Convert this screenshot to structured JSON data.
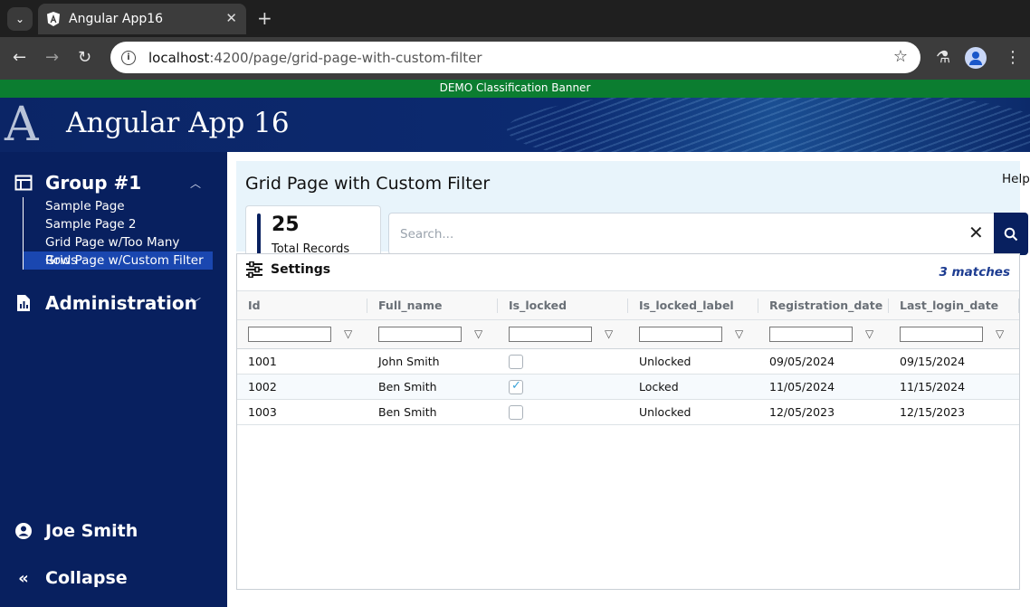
{
  "browser": {
    "tab_title": "Angular App16",
    "tab_close": "✕",
    "new_tab": "+",
    "url_host": "localhost",
    "url_rest": ":4200/page/grid-page-with-custom-filter"
  },
  "banner": {
    "text": "DEMO Classification Banner"
  },
  "header": {
    "logo_letter": "A",
    "app_title": "Angular App 16"
  },
  "sidebar": {
    "group1": {
      "label": "Group #1",
      "items": [
        {
          "label": "Sample Page"
        },
        {
          "label": "Sample Page 2"
        },
        {
          "label": "Grid Page w/Too Many Rows"
        },
        {
          "label": "Grid Page w/Custom Filter"
        }
      ]
    },
    "admin": {
      "label": "Administration"
    },
    "user": {
      "label": "Joe Smith"
    },
    "collapse": {
      "label": "Collapse"
    }
  },
  "page": {
    "title": "Grid Page with Custom Filter",
    "help": "Help",
    "records": {
      "count": "25",
      "label": "Total Records"
    },
    "search": {
      "placeholder": "Search...",
      "value": ""
    },
    "settings_label": "Settings",
    "matches": "3 matches"
  },
  "grid": {
    "columns": [
      "Id",
      "Full_name",
      "Is_locked",
      "Is_locked_label",
      "Registration_date",
      "Last_login_date"
    ],
    "rows": [
      {
        "id": "1001",
        "full_name": "John Smith",
        "is_locked": false,
        "is_locked_label": "Unlocked",
        "registration_date": "09/05/2024",
        "last_login_date": "09/15/2024"
      },
      {
        "id": "1002",
        "full_name": "Ben Smith",
        "is_locked": true,
        "is_locked_label": "Locked",
        "registration_date": "11/05/2024",
        "last_login_date": "11/15/2024"
      },
      {
        "id": "1003",
        "full_name": "Ben Smith",
        "is_locked": false,
        "is_locked_label": "Unlocked",
        "registration_date": "12/05/2023",
        "last_login_date": "12/15/2023"
      }
    ]
  },
  "colors": {
    "sidebar": "#08205f",
    "banner": "#0b7d30",
    "active_item": "#1a47b0",
    "matches": "#1d3c91"
  }
}
